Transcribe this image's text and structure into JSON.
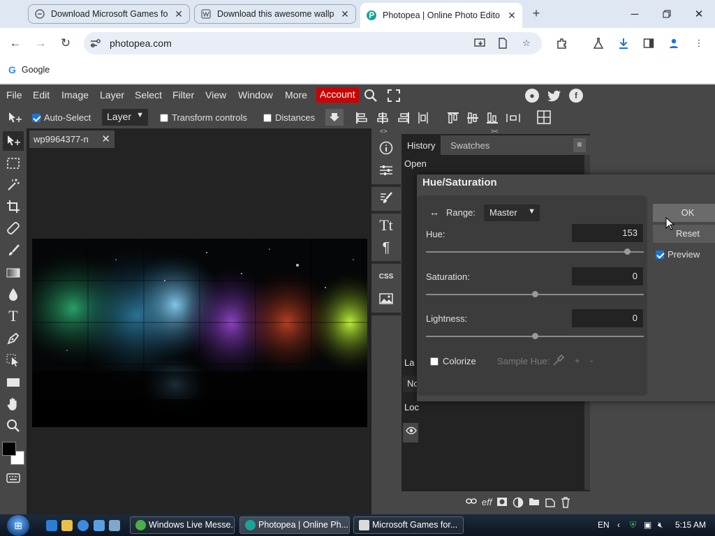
{
  "browser": {
    "tabs": [
      {
        "title": "Download Microsoft Games fo",
        "active": false
      },
      {
        "title": "Download this awesome wallp",
        "active": false
      },
      {
        "title": "Photopea | Online Photo Edito",
        "active": true
      }
    ],
    "new_tab": "+",
    "url": "photopea.com",
    "bookmark": {
      "label": "Google",
      "icon": "G"
    }
  },
  "photopea": {
    "menu": [
      "File",
      "Edit",
      "Image",
      "Layer",
      "Select",
      "Filter",
      "View",
      "Window",
      "More"
    ],
    "account": "Account",
    "options": {
      "auto_select": "Auto-Select",
      "layer_select": "Layer",
      "transform_controls": "Transform controls",
      "distances": "Distances"
    },
    "doc_tab": "wp9964377-n",
    "history_tabs": [
      "History",
      "Swatches"
    ],
    "history_items": [
      "Open"
    ],
    "layer_fragments": [
      "La",
      "No",
      "Loc"
    ],
    "layer_footer_icons": [
      "link-icon",
      "fx-icon",
      "mask-icon",
      "adjustment-icon",
      "folder-icon",
      "new-layer-icon",
      "trash-icon"
    ],
    "fx_label": "eff"
  },
  "dialog": {
    "title": "Hue/Saturation",
    "range_label": "Range:",
    "range_value": "Master",
    "hue_label": "Hue:",
    "hue_value": "153",
    "hue_fraction": 0.925,
    "saturation_label": "Saturation:",
    "saturation_value": "0",
    "saturation_fraction": 0.5,
    "lightness_label": "Lightness:",
    "lightness_value": "0",
    "lightness_fraction": 0.5,
    "colorize_label": "Colorize",
    "sample_hue_label": "Sample Hue:",
    "ok": "OK",
    "reset": "Reset",
    "preview": "Preview",
    "preview_checked": true,
    "colorize_checked": false
  },
  "taskbar": {
    "tasks": [
      "Windows Live Messe...",
      "Photopea | Online Ph...",
      "Microsoft Games for..."
    ],
    "lang": "EN",
    "time": "5:15 AM"
  },
  "colors": {
    "accent_account": "#cc0000",
    "panel": "#474747",
    "canvas_bg": "#232323"
  }
}
